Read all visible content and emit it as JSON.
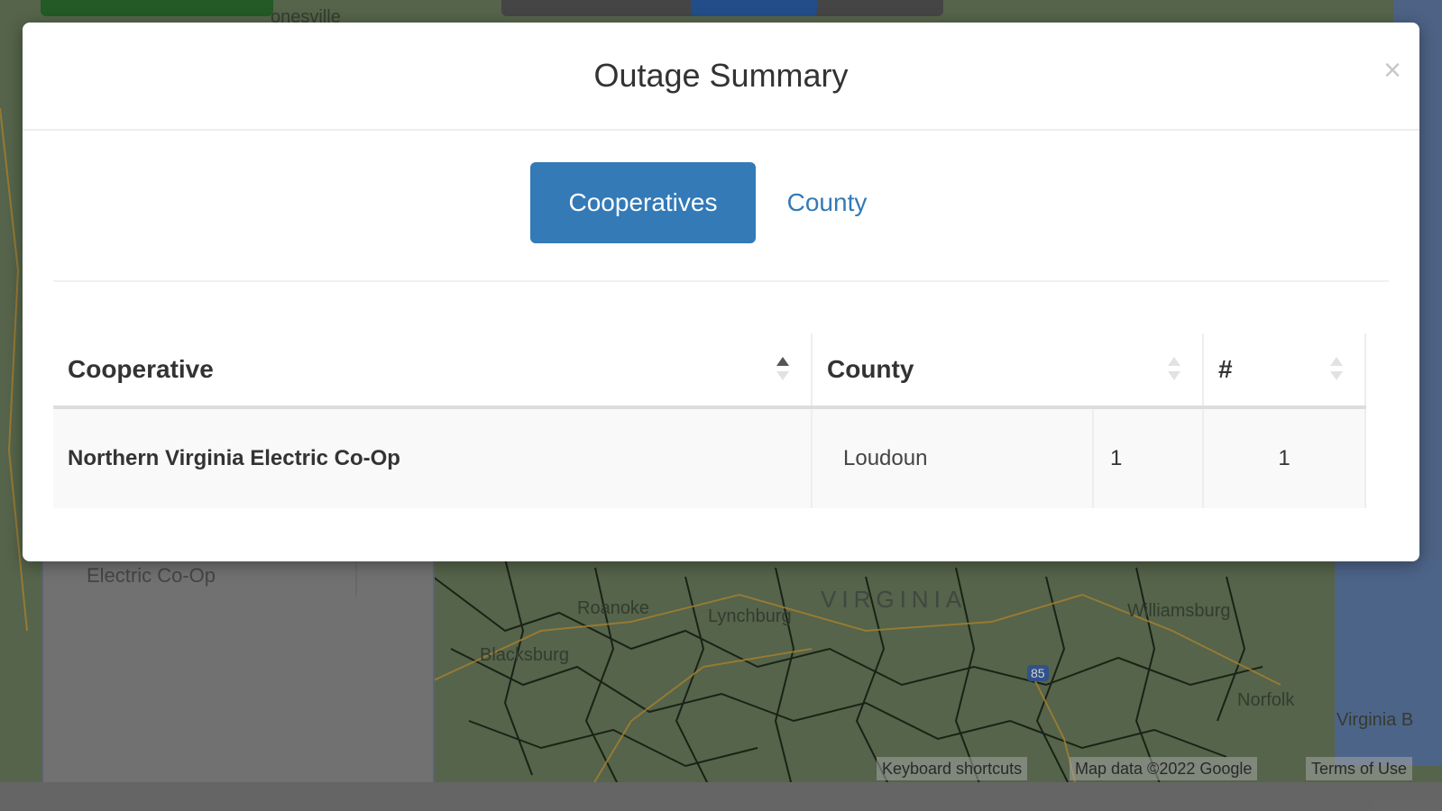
{
  "modal": {
    "title": "Outage Summary",
    "close_label": "×",
    "tabs": [
      {
        "label": "Cooperatives",
        "active": true
      },
      {
        "label": "County",
        "active": false
      }
    ],
    "table": {
      "columns": [
        "Cooperative",
        "County",
        "#"
      ],
      "rows": [
        {
          "cooperative": "Northern Virginia Electric Co-Op",
          "county": "Loudoun",
          "county_count": "1",
          "count": "1"
        }
      ]
    }
  },
  "background": {
    "side_panel_text": "Electric Co-Op",
    "map_labels": {
      "state": "VIRGINIA",
      "cities": [
        "Roanoke",
        "Lynchburg",
        "Blacksburg",
        "Williamsburg",
        "Norfolk",
        "Virginia B"
      ],
      "interstate": "85",
      "top_partial": "onesville"
    },
    "attribution": [
      "Keyboard shortcuts",
      "Map data ©2022 Google",
      "Terms of Use"
    ]
  },
  "colors": {
    "primary": "#337ab7",
    "map_green": "#67795a"
  }
}
